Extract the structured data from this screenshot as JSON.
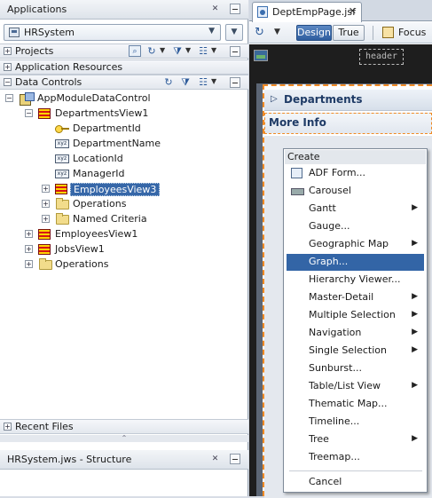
{
  "left_panel": {
    "applications": {
      "title": "Applications",
      "selected_app": "HRSystem"
    },
    "accordions": {
      "projects": "Projects",
      "application_resources": "Application Resources",
      "data_controls": "Data Controls"
    },
    "tree": {
      "root": "AppModuleDataControl",
      "departments_view": "DepartmentsView1",
      "department_id": "DepartmentId",
      "department_name": "DepartmentName",
      "location_id": "LocationId",
      "manager_id": "ManagerId",
      "employees_view3": "EmployeesView3",
      "operations": "Operations",
      "named_criteria": "Named Criteria",
      "employees_view1": "EmployeesView1",
      "jobs_view1": "JobsView1",
      "root_operations": "Operations"
    },
    "xyz_label": "xyz",
    "recent_files": "Recent Files",
    "structure": "HRSystem.jws - Structure"
  },
  "editor": {
    "tab_label": "DeptEmpPage.jsf",
    "toolbar": {
      "design": "Design",
      "true_label": "True",
      "focus": "Focus"
    },
    "canvas": {
      "header_placeholder": "header",
      "departments": "Departments",
      "more_info": "More Info"
    }
  },
  "context_menu": {
    "header": "Create",
    "items": [
      {
        "label": "ADF Form...",
        "submenu": false
      },
      {
        "label": "Carousel",
        "submenu": false
      },
      {
        "label": "Gantt",
        "submenu": true
      },
      {
        "label": "Gauge...",
        "submenu": false
      },
      {
        "label": "Geographic Map",
        "submenu": true
      },
      {
        "label": "Graph...",
        "submenu": false,
        "highlighted": true
      },
      {
        "label": "Hierarchy Viewer...",
        "submenu": false
      },
      {
        "label": "Master-Detail",
        "submenu": true
      },
      {
        "label": "Multiple Selection",
        "submenu": true
      },
      {
        "label": "Navigation",
        "submenu": true
      },
      {
        "label": "Single Selection",
        "submenu": true
      },
      {
        "label": "Sunburst...",
        "submenu": false
      },
      {
        "label": "Table/List View",
        "submenu": true
      },
      {
        "label": "Thematic Map...",
        "submenu": false
      },
      {
        "label": "Timeline...",
        "submenu": false
      },
      {
        "label": "Tree",
        "submenu": true
      },
      {
        "label": "Treemap...",
        "submenu": false
      }
    ],
    "cancel": "Cancel"
  },
  "colors": {
    "selection": "#3667a8",
    "menu_highlight": "#3365a6",
    "design_button": "#2f5e9f",
    "dashed_border": "#f08a24"
  },
  "icons": {
    "collapse": "minus",
    "expand": "plus",
    "submenu": "triangle-right",
    "close": "x"
  }
}
